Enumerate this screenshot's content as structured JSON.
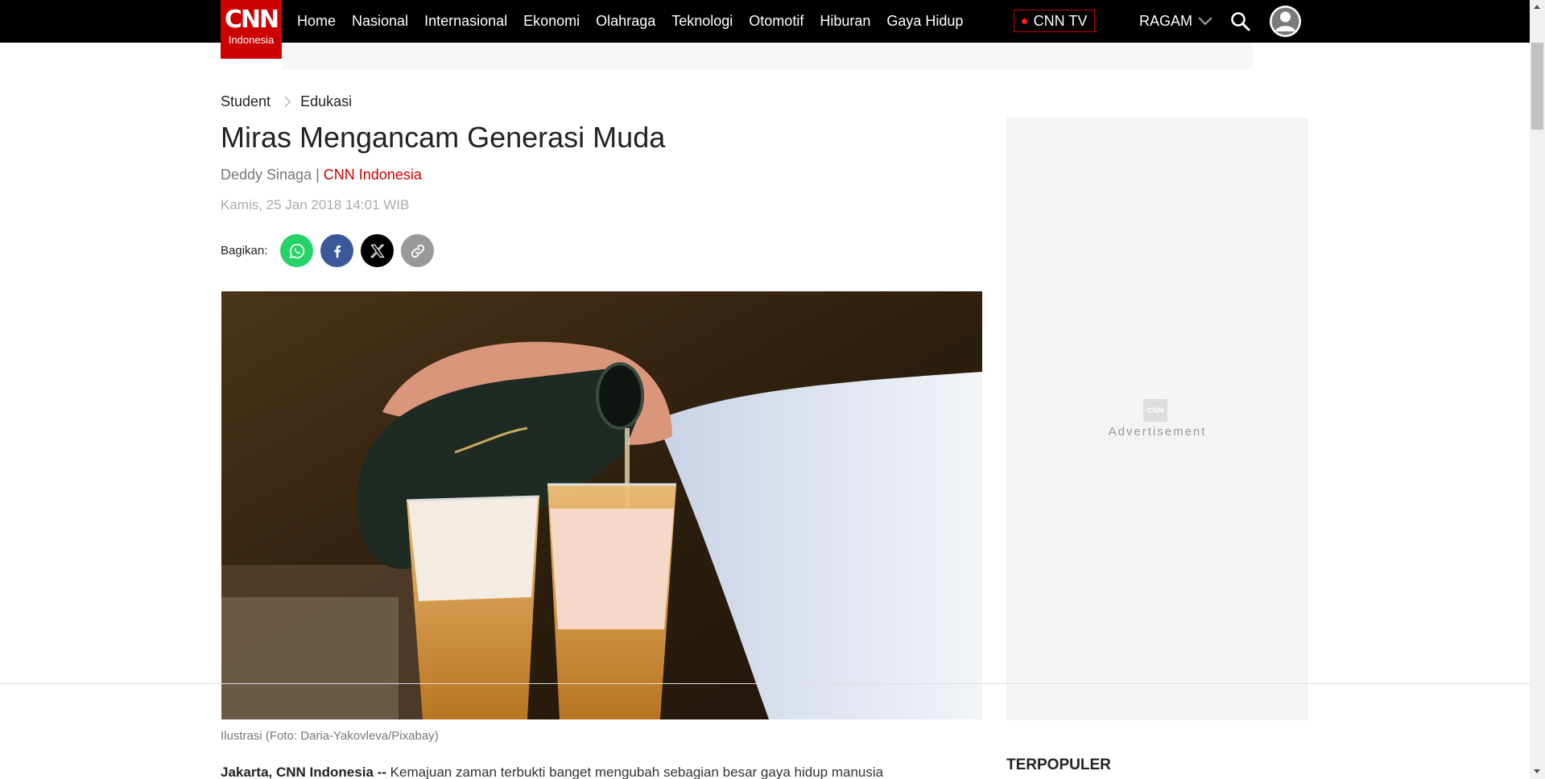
{
  "header": {
    "logo_text": "CNN",
    "logo_sub": "Indonesia",
    "nav": [
      "Home",
      "Nasional",
      "Internasional",
      "Ekonomi",
      "Olahraga",
      "Teknologi",
      "Otomotif",
      "Hiburan",
      "Gaya Hidup"
    ],
    "cnntv_label": "CNN TV",
    "ragam_label": "RAGAM",
    "search_icon": "search-icon",
    "avatar_icon": "user-avatar-icon"
  },
  "breadcrumb": [
    "Student",
    "Edukasi"
  ],
  "article": {
    "title": "Miras Mengancam Generasi Muda",
    "author": "Deddy Sinaga |",
    "source": "CNN Indonesia",
    "date": "Kamis, 25 Jan 2018 14:01 WIB",
    "share_label": "Bagikan:",
    "share_icons": [
      "whatsapp-icon",
      "facebook-icon",
      "x-icon",
      "link-icon"
    ],
    "photo_caption": "Ilustrasi (Foto: Daria-Yakovleva/Pixabay)",
    "body_lead": "Jakarta, CNN Indonesia --",
    "body_text": " Kemajuan zaman terbukti banget mengubah sebagian besar gaya hidup manusia"
  },
  "sidebar": {
    "ad_mark": "CNN",
    "ad_label": "Advertisement",
    "terpopuler": "TERPOPULER"
  },
  "colors": {
    "brand": "#cc0000",
    "nav_bg": "#000000"
  }
}
